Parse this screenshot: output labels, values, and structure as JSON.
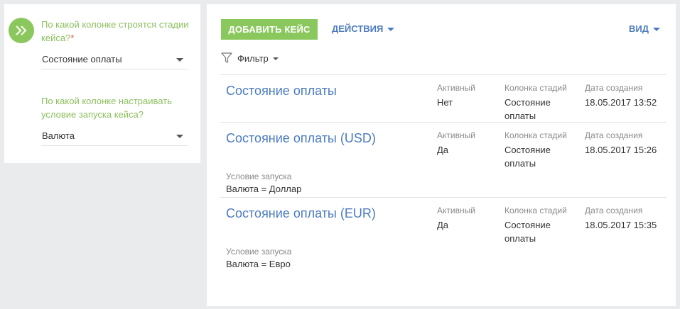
{
  "left_panel": {
    "question1": "По какой колонке строятся стадии кейса?",
    "required_mark": "*",
    "select1_value": "Состояние оплаты",
    "question2": "По какой колонке настраивать условие запуска кейса?",
    "select2_value": "Валюта"
  },
  "toolbar": {
    "add_label": "ДОБАВИТЬ КЕЙС",
    "actions_label": "ДЕЙСТВИЯ",
    "view_label": "ВИД",
    "filter_label": "Фильтр"
  },
  "columns": {
    "active": "Активный",
    "stage": "Колонка стадий",
    "date": "Дата создания",
    "condition": "Условие запуска"
  },
  "rows": [
    {
      "title": "Состояние оплаты",
      "active": "Нет",
      "stage": "Состояние оплаты",
      "date": "18.05.2017 13:52",
      "condition": ""
    },
    {
      "title": "Состояние оплаты (USD)",
      "active": "Да",
      "stage": "Состояние оплаты",
      "date": "18.05.2017 15:26",
      "condition": "Валюта = Доллар"
    },
    {
      "title": "Состояние оплаты (EUR)",
      "active": "Да",
      "stage": "Состояние оплаты",
      "date": "18.05.2017 15:35",
      "condition": "Валюта = Евро"
    }
  ],
  "icons": {
    "next": "double-chevron-right-icon",
    "filter": "funnel-icon"
  },
  "colors": {
    "accent_green": "#8ac75c",
    "link_blue": "#4b7bbf",
    "required_red": "#e5584f"
  }
}
